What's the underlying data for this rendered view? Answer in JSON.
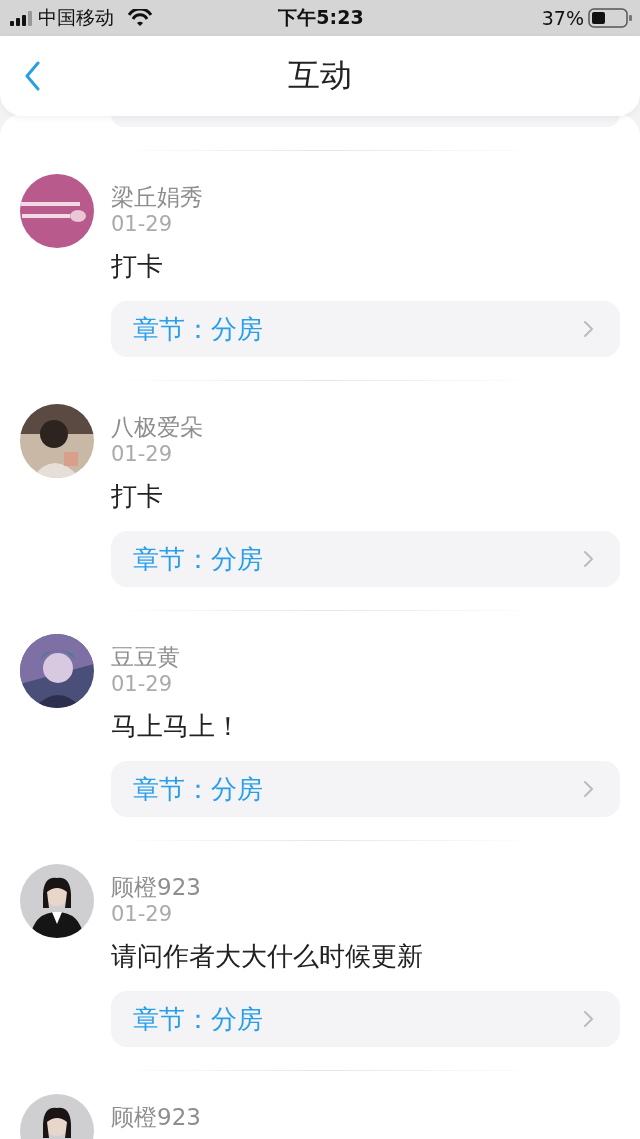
{
  "status_bar": {
    "carrier": "中国移动",
    "time": "下午5:23",
    "battery": "37%"
  },
  "nav": {
    "title": "互动"
  },
  "comments": [
    {
      "name": "梁丘娟秀",
      "date": "01-29",
      "text": "打卡",
      "chapter": "章节：分房"
    },
    {
      "name": "八极爱朵",
      "date": "01-29",
      "text": "打卡",
      "chapter": "章节：分房"
    },
    {
      "name": "豆豆黄",
      "date": "01-29",
      "text": "马上马上！",
      "chapter": "章节：分房"
    },
    {
      "name": "顾橙923",
      "date": "01-29",
      "text": "请问作者大大什么时候更新",
      "chapter": "章节：分房"
    },
    {
      "name": "顾橙923"
    }
  ]
}
